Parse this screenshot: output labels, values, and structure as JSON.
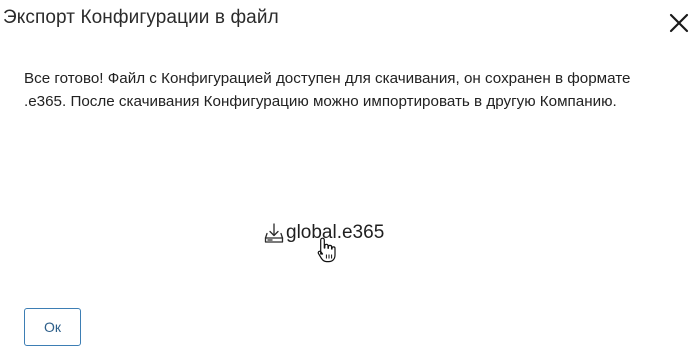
{
  "dialog": {
    "title": "Экспорт Конфигурации в файл",
    "close_icon": "close-icon",
    "message": "Все готово! Файл с Конфигурацией доступен для скачивания, он сохранен в формате .e365. После скачивания Конфигурацию можно импортировать в другую Компанию.",
    "download": {
      "icon": "download-icon",
      "file_name": "global.e365"
    },
    "ok_label": "Ок"
  },
  "colors": {
    "button_border": "#3d7eb4",
    "button_text": "#2d5f8a",
    "text": "#222222",
    "background": "#ffffff"
  },
  "cursor": "hand-pointer-icon"
}
